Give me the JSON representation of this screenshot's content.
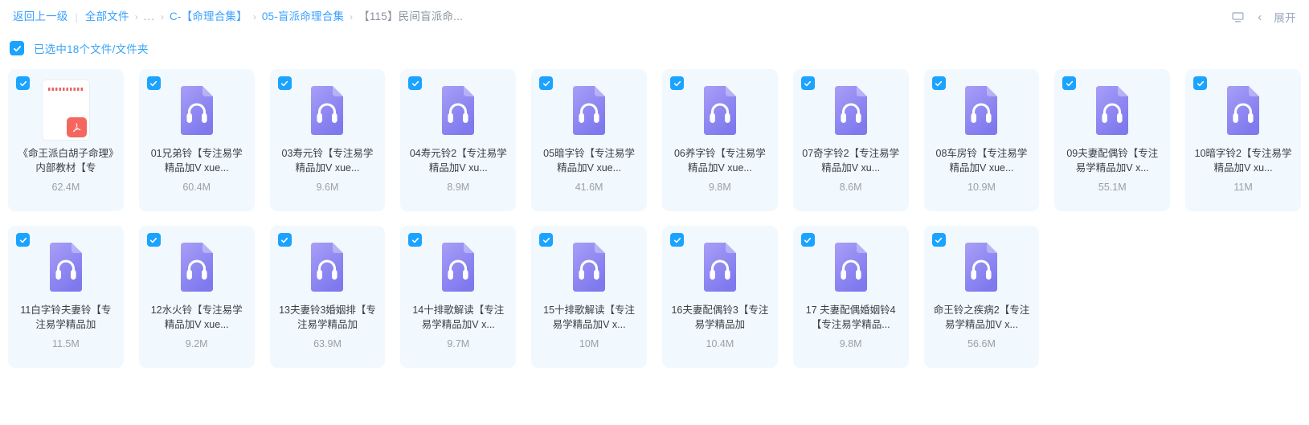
{
  "header": {
    "back_label": "返回上一级",
    "separator": "|",
    "arrow": "›",
    "breadcrumbs": [
      {
        "label": "全部文件",
        "type": "link"
      },
      {
        "label": "...",
        "type": "ellipsis"
      },
      {
        "label": "C-【命理合集】",
        "type": "link"
      },
      {
        "label": "05-盲派命理合集",
        "type": "link"
      },
      {
        "label": "【115】民间盲派命...",
        "type": "current"
      }
    ],
    "monitor_icon": "monitor-icon",
    "collapse_icon": "chevron-left-icon",
    "expand_label": "展开"
  },
  "selection": {
    "checked": true,
    "label": "已选中18个文件/文件夹",
    "check_icon": "check-icon"
  },
  "colors": {
    "accent_blue": "#1aa3ff",
    "link_blue": "#3aa0ff",
    "card_bg": "#f1f8fe",
    "audio_icon_purple": "#8b84f0",
    "pdf_red": "#f4675f",
    "name_text": "#3c4043",
    "size_text": "#9aa0a6"
  },
  "files": [
    {
      "name": "《命王派白胡子命理》内部教材【专",
      "size": "62.4M",
      "kind": "pdf",
      "selected": true,
      "icon": "pdf-file-icon"
    },
    {
      "name": "01兄弟铃【专注易学精品加V xue...",
      "size": "60.4M",
      "kind": "audio",
      "selected": true,
      "icon": "audio-file-icon"
    },
    {
      "name": "03寿元铃【专注易学精品加V xue...",
      "size": "9.6M",
      "kind": "audio",
      "selected": true,
      "icon": "audio-file-icon"
    },
    {
      "name": "04寿元铃2【专注易学精品加V xu...",
      "size": "8.9M",
      "kind": "audio",
      "selected": true,
      "icon": "audio-file-icon"
    },
    {
      "name": "05暗字铃【专注易学精品加V xue...",
      "size": "41.6M",
      "kind": "audio",
      "selected": true,
      "icon": "audio-file-icon"
    },
    {
      "name": "06养字铃【专注易学精品加V xue...",
      "size": "9.8M",
      "kind": "audio",
      "selected": true,
      "icon": "audio-file-icon"
    },
    {
      "name": "07奇字铃2【专注易学精品加V xu...",
      "size": "8.6M",
      "kind": "audio",
      "selected": true,
      "icon": "audio-file-icon"
    },
    {
      "name": "08车房铃【专注易学精品加V xue...",
      "size": "10.9M",
      "kind": "audio",
      "selected": true,
      "icon": "audio-file-icon"
    },
    {
      "name": "09夫妻配偶铃【专注易学精品加V x...",
      "size": "55.1M",
      "kind": "audio",
      "selected": true,
      "icon": "audio-file-icon"
    },
    {
      "name": "10暗字铃2【专注易学精品加V xu...",
      "size": "11M",
      "kind": "audio",
      "selected": true,
      "icon": "audio-file-icon"
    },
    {
      "name": "11白字铃夫妻铃【专注易学精品加",
      "size": "11.5M",
      "kind": "audio",
      "selected": true,
      "icon": "audio-file-icon"
    },
    {
      "name": "12水火铃【专注易学精品加V xue...",
      "size": "9.2M",
      "kind": "audio",
      "selected": true,
      "icon": "audio-file-icon"
    },
    {
      "name": "13夫妻铃3婚姻排【专注易学精品加",
      "size": "63.9M",
      "kind": "audio",
      "selected": true,
      "icon": "audio-file-icon"
    },
    {
      "name": "14十排歌解读【专注易学精品加V x...",
      "size": "9.7M",
      "kind": "audio",
      "selected": true,
      "icon": "audio-file-icon"
    },
    {
      "name": "15十排歌解读【专注易学精品加V x...",
      "size": "10M",
      "kind": "audio",
      "selected": true,
      "icon": "audio-file-icon"
    },
    {
      "name": "16夫妻配偶铃3【专注易学精品加",
      "size": "10.4M",
      "kind": "audio",
      "selected": true,
      "icon": "audio-file-icon"
    },
    {
      "name": "17 夫妻配偶婚姻铃4【专注易学精品...",
      "size": "9.8M",
      "kind": "audio",
      "selected": true,
      "icon": "audio-file-icon"
    },
    {
      "name": "命王铃之疾病2【专注易学精品加V x...",
      "size": "56.6M",
      "kind": "audio",
      "selected": true,
      "icon": "audio-file-icon"
    }
  ]
}
